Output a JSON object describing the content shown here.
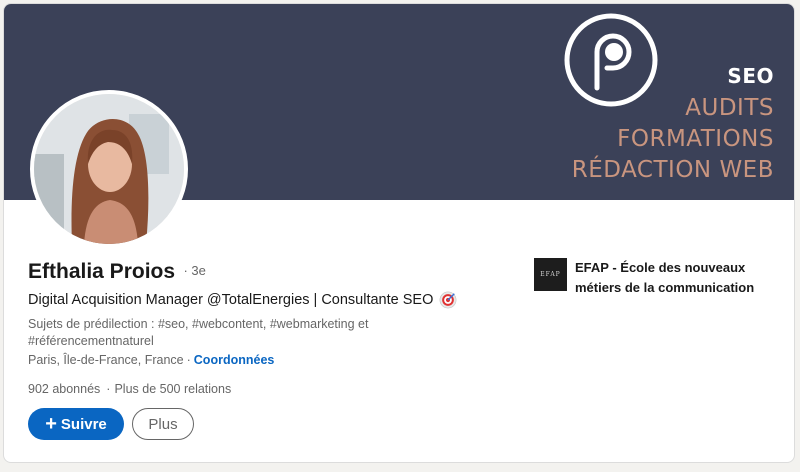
{
  "profile": {
    "name": "Efthalia Proios",
    "degree": "· 3e",
    "headline": "Digital Acquisition Manager @TotalEnergies | Consultante SEO",
    "topics": "Sujets de prédilection : #seo, #webcontent, #webmarketing et #référencementnaturel",
    "location": "Paris, Île-de-France, France",
    "location_separator": "·",
    "contact_link": "Coordonnées",
    "followers": "902 abonnés",
    "stats_separator": "·",
    "connections": "Plus de 500 relations"
  },
  "banner": {
    "line_seo": "SEO",
    "line_1": "AUDITS",
    "line_2": "FORMATIONS",
    "line_3": "RÉDACTION WEB",
    "background_color": "#3b4158",
    "accent_color": "#c9957f"
  },
  "actions": {
    "follow_label": "Suivre",
    "follow_icon": "+",
    "more_label": "Plus"
  },
  "company": {
    "logo_text": "EFAP",
    "name": "EFAP - École des nouveaux métiers de la communication"
  },
  "colors": {
    "link": "#0a66c2",
    "primary_button": "#0a66c2"
  },
  "icons": {
    "headline_emoji": "target-icon",
    "banner_logo": "p-circle-logo-icon"
  }
}
